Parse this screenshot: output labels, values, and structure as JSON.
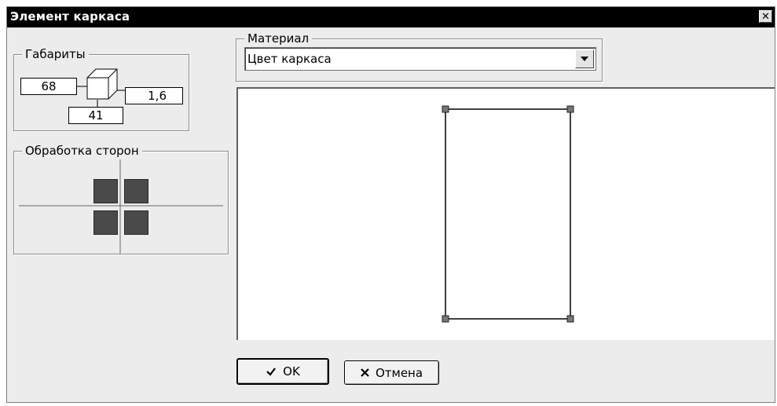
{
  "window": {
    "title": "Элемент каркаса",
    "close_glyph": "✕"
  },
  "dimensions": {
    "label": "Габариты",
    "width": "68",
    "depth": "1,6",
    "height": "41"
  },
  "sides": {
    "label": "Обработка сторон"
  },
  "material": {
    "label": "Материал",
    "selected": "Цвет каркаса"
  },
  "buttons": {
    "ok_label": "OK",
    "ok_icon": "checkmark-icon",
    "cancel_label": "Отмена",
    "cancel_icon": "cross-icon"
  },
  "colors": {
    "titlebar": "#000000",
    "side_square": "#4a4a4a",
    "dialog_bg": "#ececec"
  }
}
